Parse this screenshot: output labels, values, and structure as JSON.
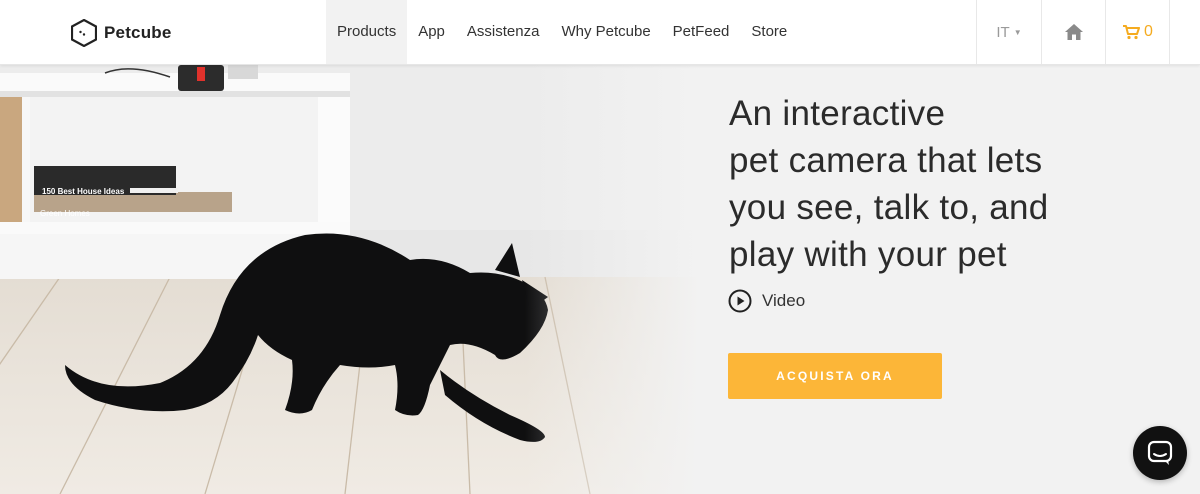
{
  "brand": {
    "name": "Petcube",
    "icon": "petcube-logo-icon"
  },
  "nav": {
    "items": [
      {
        "label": "Products",
        "active": true
      },
      {
        "label": "App"
      },
      {
        "label": "Assistenza"
      },
      {
        "label": "Why Petcube"
      },
      {
        "label": "PetFeed"
      },
      {
        "label": "Store"
      }
    ]
  },
  "header_right": {
    "language": "IT",
    "home_icon": "home-icon",
    "cart_icon": "cart-icon",
    "cart_count": "0"
  },
  "hero": {
    "headline_lines": [
      "An interactive",
      "pet camera that lets",
      "you see, talk to, and",
      "play with your pet"
    ],
    "video_label": "Video",
    "cta_label": "ACQUISTA ORA",
    "books": [
      "150 Best House Ideas",
      "Green Homes"
    ]
  },
  "colors": {
    "accent": "#fcb638",
    "cart": "#f5ab1f",
    "text": "#2b2b2b",
    "background": "#f2f2f2"
  },
  "chat": {
    "icon": "chat-bubble-icon"
  }
}
